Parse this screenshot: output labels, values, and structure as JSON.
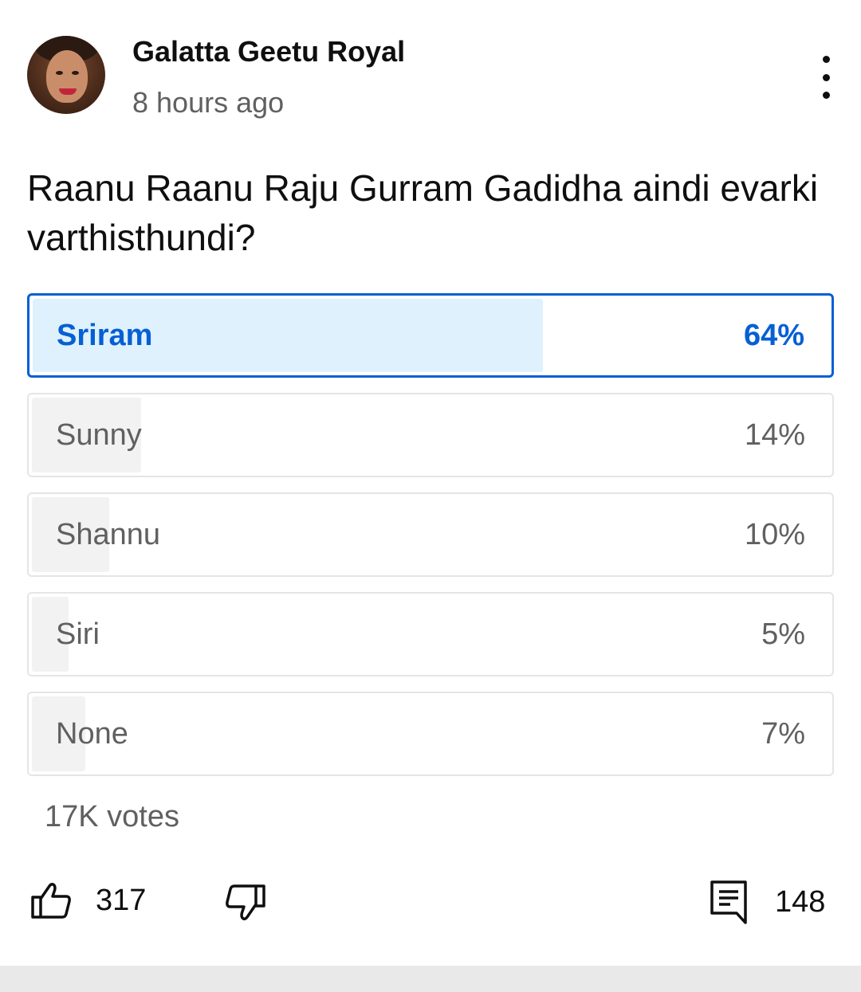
{
  "post": {
    "channel_name": "Galatta Geetu Royal",
    "timestamp": "8 hours ago",
    "question": "Raanu Raanu Raju Gurram Gadidha aindi evarki varthisthundi?"
  },
  "poll": {
    "options": [
      {
        "label": "Sriram",
        "percent_text": "64%",
        "percent": 64,
        "selected": true
      },
      {
        "label": "Sunny",
        "percent_text": "14%",
        "percent": 14,
        "selected": false
      },
      {
        "label": "Shannu",
        "percent_text": "10%",
        "percent": 10,
        "selected": false
      },
      {
        "label": "Siri",
        "percent_text": "5%",
        "percent": 5,
        "selected": false
      },
      {
        "label": "None",
        "percent_text": "7%",
        "percent": 7,
        "selected": false
      }
    ],
    "votes": "17K votes"
  },
  "actions": {
    "like_count": "317",
    "comment_count": "148"
  },
  "colors": {
    "selected_accent": "#065fd4",
    "selected_fill": "#def1fd",
    "unselected_fill": "#f2f2f2",
    "secondary_text": "#606060"
  },
  "icons": {
    "menu": "more-vert-icon",
    "like": "thumb-up-icon",
    "dislike": "thumb-down-icon",
    "comment": "comment-icon"
  }
}
